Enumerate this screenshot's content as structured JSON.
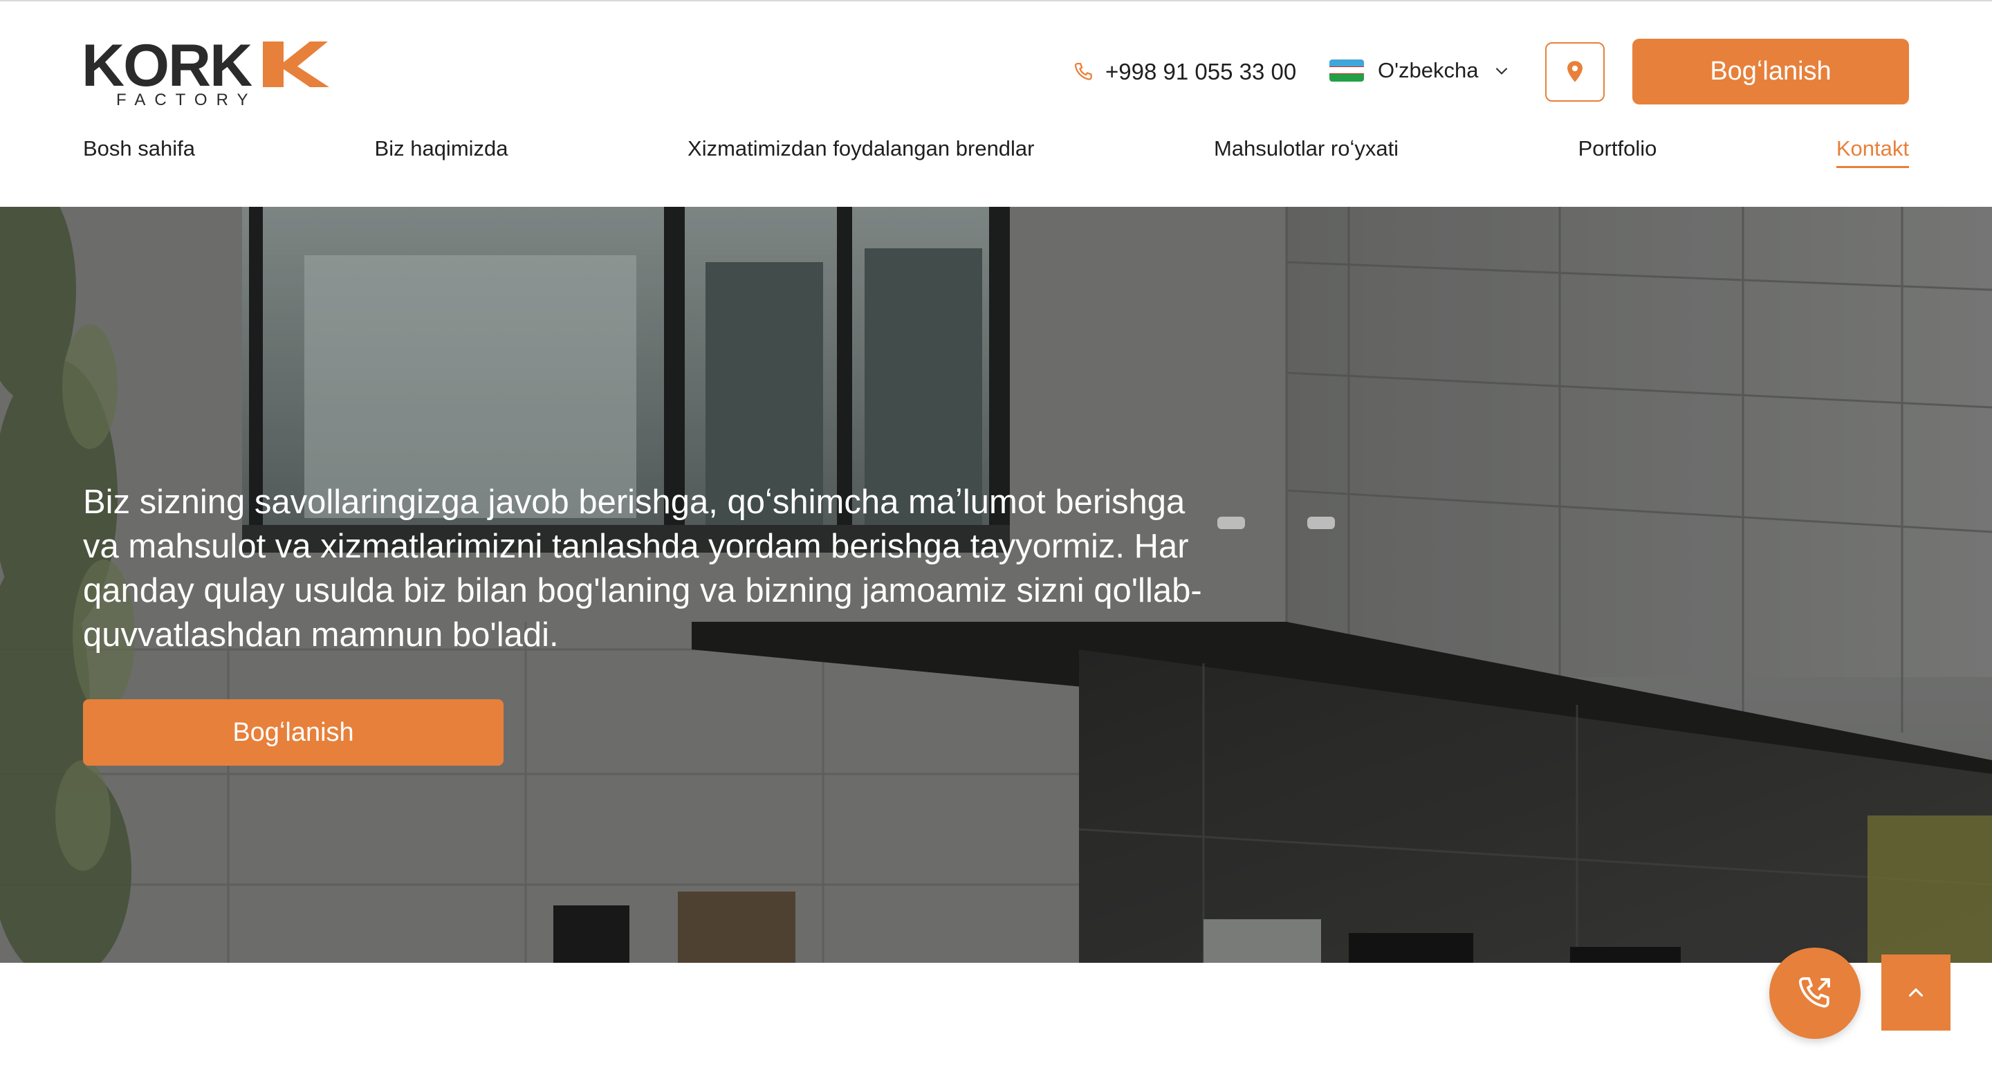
{
  "brand": {
    "name": "KORK",
    "tagline": "FACTORY",
    "accent_color": "#e7803b"
  },
  "header": {
    "phone": "+998 91 055 33 00",
    "phone_icon": "phone-icon",
    "language": "O'zbekcha",
    "language_icon": "uzbekistan-flag-icon",
    "location_icon": "map-pin-icon",
    "cta_label": "Bogʻlanish"
  },
  "nav": {
    "items": [
      {
        "label": "Bosh sahifa"
      },
      {
        "label": "Biz haqimizda"
      },
      {
        "label": "Xizmatimizdan foydalangan brendlar"
      },
      {
        "label": "Mahsulotlar roʻyxati"
      },
      {
        "label": "Portfolio"
      },
      {
        "label": "Kontakt",
        "active": true
      }
    ]
  },
  "hero": {
    "text": "Biz sizning savollaringizga javob berishga, qoʻshimcha maʼlumot berishga va mahsulot va xizmatlarimizni tanlashda yordam berishga tayyormiz. Har qanday qulay usulda biz bilan bog'laning va bizning jamoamiz sizni qo'llab-quvvatlashdan mamnun bo'ladi.",
    "cta_label": "Bogʻlanish"
  },
  "floating": {
    "call_icon": "phone-outgoing-icon",
    "top_icon": "chevron-up-icon"
  }
}
